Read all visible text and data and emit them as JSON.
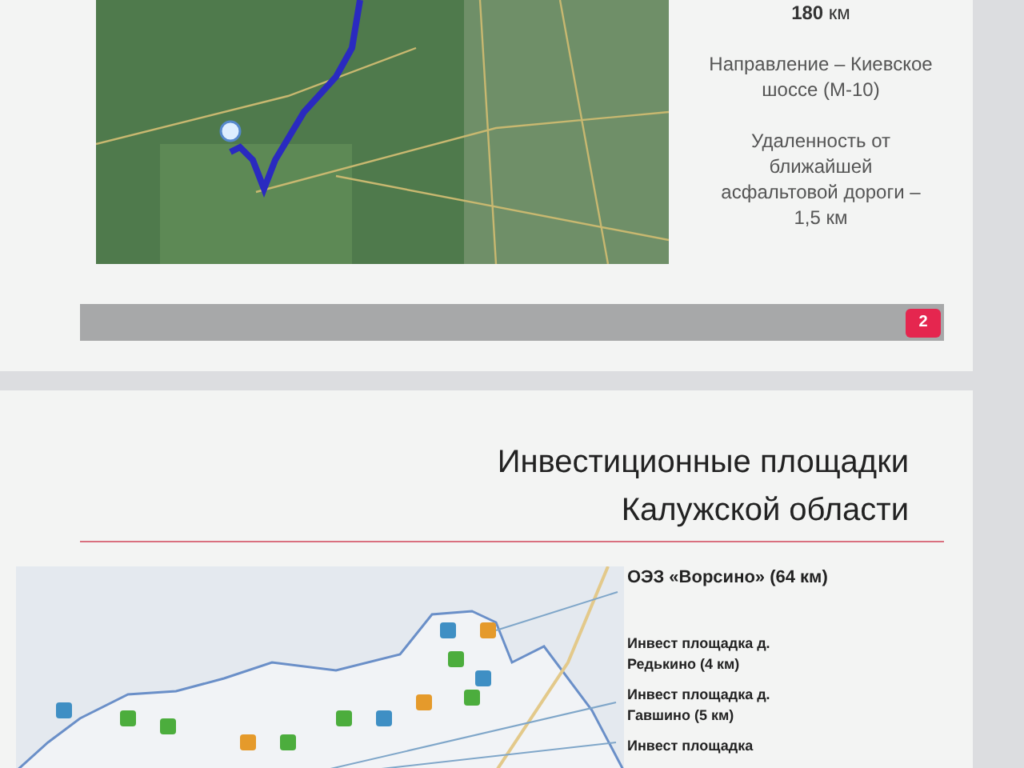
{
  "slide_1": {
    "distance": "**180** км",
    "details": [
      "Направление – Киевское шоссе (М-10)",
      "Удаленность от ближайшей асфальтовой дороги – 1,5 км"
    ],
    "page_number": "2"
  },
  "slide_2": {
    "title_lines": [
      "Инвестиционные площадки",
      "Калужской области"
    ],
    "callouts": [
      {
        "text": "ОЭЗ «Ворсино» (64 км)",
        "kind": "main"
      },
      {
        "text": "Инвест площадка д. Редькино (4 км)",
        "kind": "minor"
      },
      {
        "text": "Инвест площадка д. Гавшино (5 км)",
        "kind": "minor"
      },
      {
        "text": "Инвест площадка",
        "kind": "minor"
      }
    ]
  }
}
